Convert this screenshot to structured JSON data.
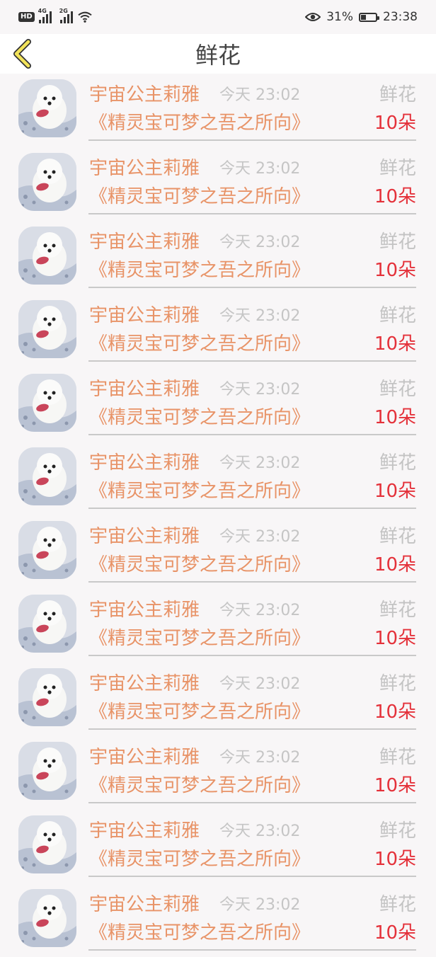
{
  "status_bar": {
    "hd": "HD",
    "sim1_gen": "4G",
    "sim2_gen": "2G",
    "battery": "31%",
    "time": "23:38"
  },
  "header": {
    "title": "鲜花"
  },
  "records": [
    {
      "name": "宇宙公主莉雅",
      "time": "今天 23:02",
      "type": "鲜花",
      "book": "《精灵宝可梦之吾之所向》",
      "count": "10朵"
    },
    {
      "name": "宇宙公主莉雅",
      "time": "今天 23:02",
      "type": "鲜花",
      "book": "《精灵宝可梦之吾之所向》",
      "count": "10朵"
    },
    {
      "name": "宇宙公主莉雅",
      "time": "今天 23:02",
      "type": "鲜花",
      "book": "《精灵宝可梦之吾之所向》",
      "count": "10朵"
    },
    {
      "name": "宇宙公主莉雅",
      "time": "今天 23:02",
      "type": "鲜花",
      "book": "《精灵宝可梦之吾之所向》",
      "count": "10朵"
    },
    {
      "name": "宇宙公主莉雅",
      "time": "今天 23:02",
      "type": "鲜花",
      "book": "《精灵宝可梦之吾之所向》",
      "count": "10朵"
    },
    {
      "name": "宇宙公主莉雅",
      "time": "今天 23:02",
      "type": "鲜花",
      "book": "《精灵宝可梦之吾之所向》",
      "count": "10朵"
    },
    {
      "name": "宇宙公主莉雅",
      "time": "今天 23:02",
      "type": "鲜花",
      "book": "《精灵宝可梦之吾之所向》",
      "count": "10朵"
    },
    {
      "name": "宇宙公主莉雅",
      "time": "今天 23:02",
      "type": "鲜花",
      "book": "《精灵宝可梦之吾之所向》",
      "count": "10朵"
    },
    {
      "name": "宇宙公主莉雅",
      "time": "今天 23:02",
      "type": "鲜花",
      "book": "《精灵宝可梦之吾之所向》",
      "count": "10朵"
    },
    {
      "name": "宇宙公主莉雅",
      "time": "今天 23:02",
      "type": "鲜花",
      "book": "《精灵宝可梦之吾之所向》",
      "count": "10朵"
    },
    {
      "name": "宇宙公主莉雅",
      "time": "今天 23:02",
      "type": "鲜花",
      "book": "《精灵宝可梦之吾之所向》",
      "count": "10朵"
    },
    {
      "name": "宇宙公主莉雅",
      "time": "今天 23:02",
      "type": "鲜花",
      "book": "《精灵宝可梦之吾之所向》",
      "count": "10朵"
    }
  ],
  "colors": {
    "accent": "#e89367",
    "count": "#e4313a",
    "muted": "#c3c3c3",
    "back_arrow": "#f2e35a"
  }
}
